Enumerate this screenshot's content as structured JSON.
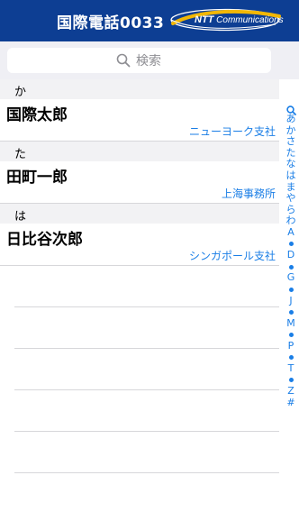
{
  "header": {
    "title": "国際電話0033",
    "logo_brand": "NTT",
    "logo_suffix": "Communications",
    "background": "#0d3e93"
  },
  "search": {
    "placeholder": "検索",
    "icon": "search-icon"
  },
  "sections": [
    {
      "header": "か",
      "contacts": [
        {
          "name": "国際太郎",
          "office": "ニューヨーク支社"
        }
      ]
    },
    {
      "header": "た",
      "contacts": [
        {
          "name": "田町一郎",
          "office": "上海事務所"
        }
      ]
    },
    {
      "header": "は",
      "contacts": [
        {
          "name": "日比谷次郎",
          "office": "シンガポール支社"
        }
      ]
    }
  ],
  "index": {
    "items": [
      "あ",
      "か",
      "さ",
      "た",
      "な",
      "は",
      "ま",
      "や",
      "ら",
      "わ",
      "A",
      "D",
      "G",
      "J",
      "M",
      "P",
      "T",
      "Z",
      "#"
    ],
    "accent": "#1a7ee6"
  }
}
